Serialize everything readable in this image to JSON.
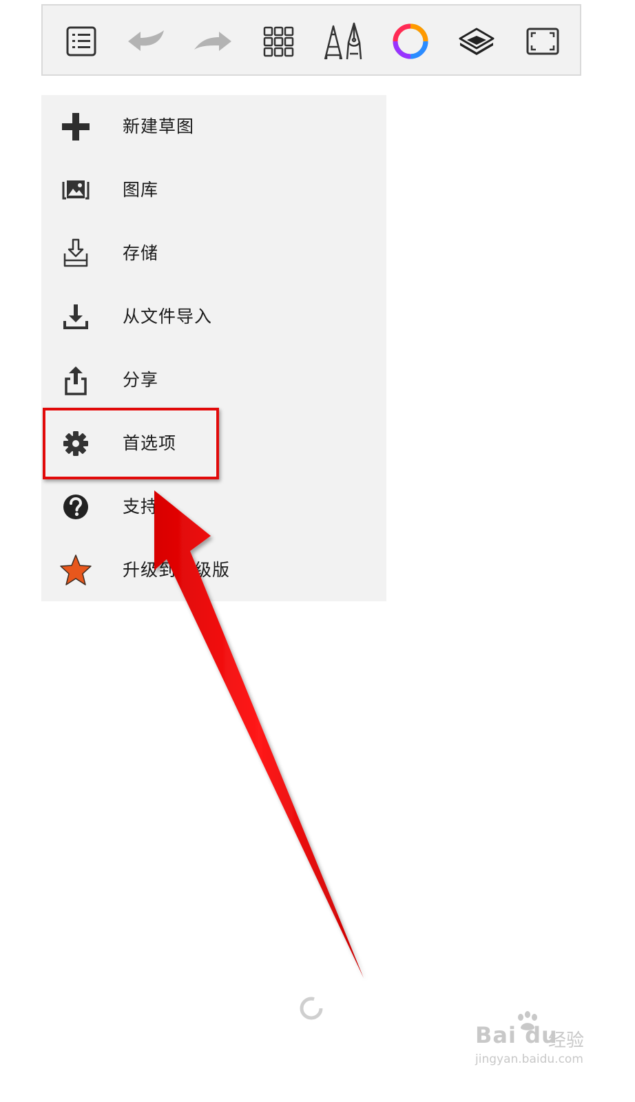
{
  "toolbar": {
    "buttons": [
      {
        "name": "menu-list-icon",
        "label": "menu"
      },
      {
        "name": "undo-icon",
        "label": "undo"
      },
      {
        "name": "redo-icon",
        "label": "redo"
      },
      {
        "name": "grid-icon",
        "label": "grid"
      },
      {
        "name": "brush-pen-icon",
        "label": "brushes"
      },
      {
        "name": "color-wheel-icon",
        "label": "color"
      },
      {
        "name": "layers-icon",
        "label": "layers"
      },
      {
        "name": "fullscreen-icon",
        "label": "fullscreen"
      }
    ]
  },
  "menu": {
    "items": [
      {
        "icon": "plus-icon",
        "label": "新建草图"
      },
      {
        "icon": "gallery-icon",
        "label": "图库"
      },
      {
        "icon": "save-icon",
        "label": "存储"
      },
      {
        "icon": "import-icon",
        "label": "从文件导入"
      },
      {
        "icon": "share-icon",
        "label": "分享"
      },
      {
        "icon": "gear-icon",
        "label": "首选项"
      },
      {
        "icon": "help-icon",
        "label": "支持"
      },
      {
        "icon": "star-icon",
        "label": "升级到高级版"
      }
    ]
  },
  "colors": {
    "highlight": "#e10a0a",
    "star": "#e8571c",
    "menu_bg": "#f2f2f2",
    "icon_dark": "#333333",
    "icon_disabled": "#b3b3b3"
  },
  "watermark": {
    "brand": "Bai du",
    "sub": "经验",
    "url": "jingyan.baidu.com"
  }
}
